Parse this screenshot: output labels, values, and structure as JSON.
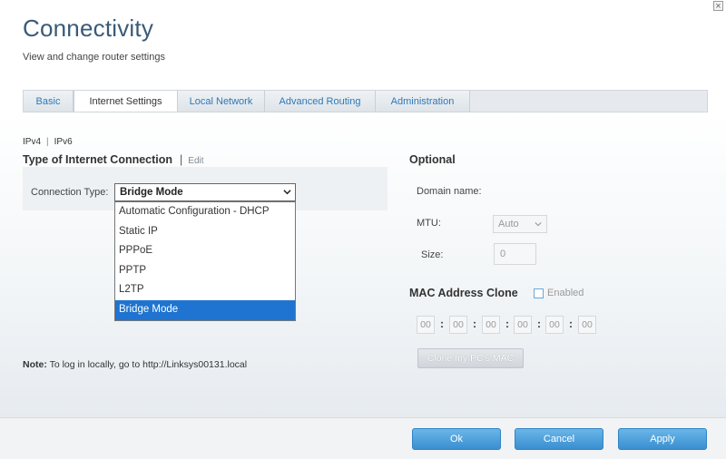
{
  "header": {
    "title": "Connectivity",
    "subtitle": "View and change router settings"
  },
  "tabs": [
    {
      "label": "Basic"
    },
    {
      "label": "Internet Settings"
    },
    {
      "label": "Local Network"
    },
    {
      "label": "Advanced Routing"
    },
    {
      "label": "Administration"
    }
  ],
  "ip": {
    "v4": "IPv4",
    "separator": "|",
    "v6": "IPv6"
  },
  "connection": {
    "heading": "Type of Internet Connection",
    "edit_separator": "|",
    "edit_label": "Edit",
    "type_label": "Connection Type:",
    "selected": "Bridge Mode",
    "options": [
      "Automatic Configuration - DHCP",
      "Static IP",
      "PPPoE",
      "PPTP",
      "L2TP",
      "Bridge Mode"
    ]
  },
  "note": {
    "label": "Note:",
    "text": " To log in locally, go to http://Linksys00131.local"
  },
  "optional": {
    "heading": "Optional",
    "domain_label": "Domain name:",
    "mtu_label": "MTU:",
    "mtu_value": "Auto",
    "size_label": "Size:",
    "size_value": "0"
  },
  "mac": {
    "heading": "MAC Address Clone",
    "enabled_label": "Enabled",
    "octets": [
      "00",
      "00",
      "00",
      "00",
      "00",
      "00"
    ],
    "colon": ":",
    "clone_button": "Clone my PC's MAC"
  },
  "footer": {
    "ok": "Ok",
    "cancel": "Cancel",
    "apply": "Apply"
  },
  "colors": {
    "title": "#3a5a78",
    "tab_link": "#2e78b8",
    "selected_option": "#1e74d0",
    "primary_button": "#3a8fd0"
  }
}
